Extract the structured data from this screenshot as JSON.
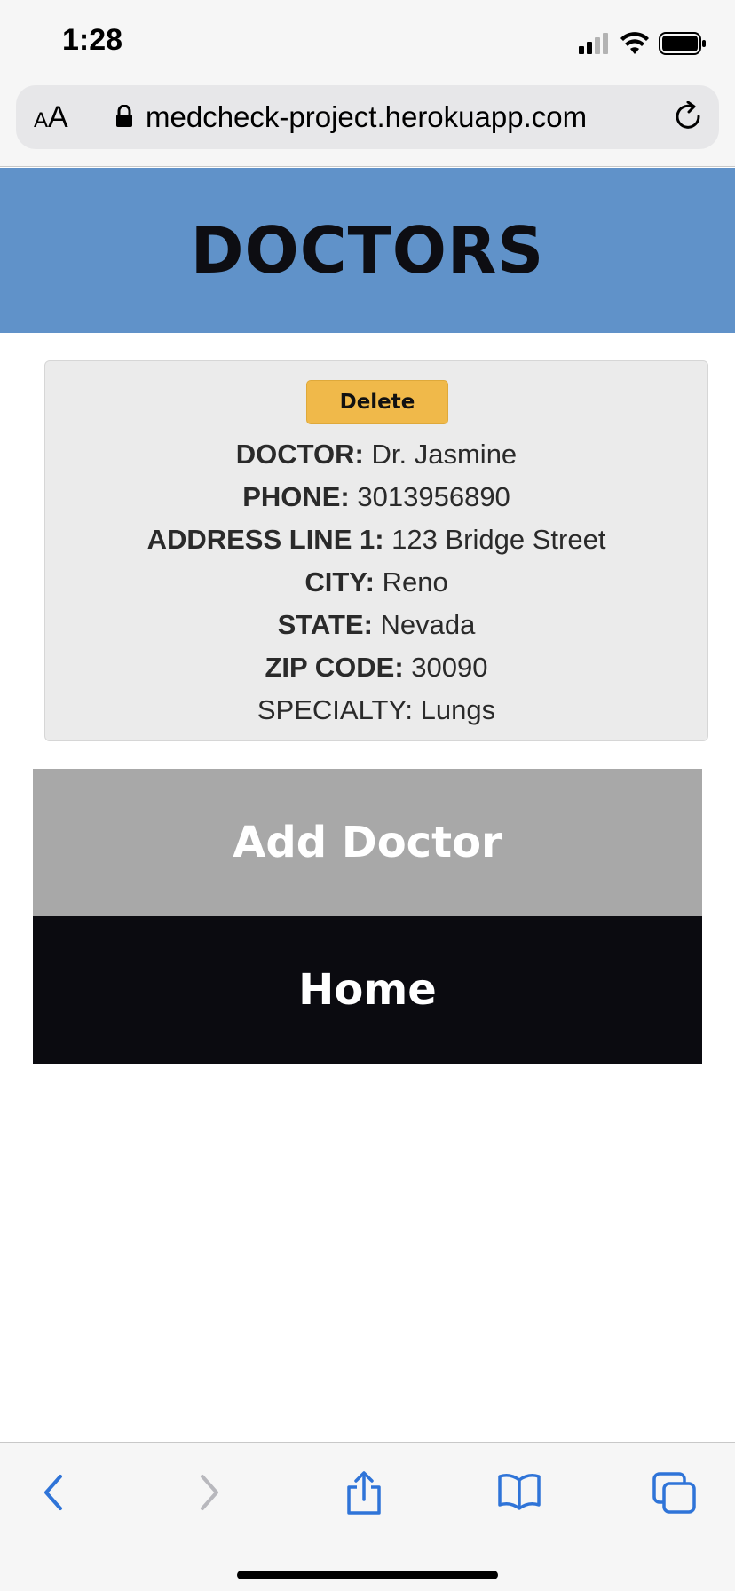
{
  "status_bar": {
    "time": "1:28",
    "icons": [
      "signal-icon",
      "wifi-icon",
      "battery-icon"
    ]
  },
  "browser": {
    "text_size_label_small": "A",
    "text_size_label_large": "A",
    "url": "medcheck-project.herokuapp.com"
  },
  "header": {
    "title": "DOCTORS",
    "background": "#6092c9"
  },
  "doctor_card": {
    "delete_label": "Delete",
    "fields": [
      {
        "label": "DOCTOR:",
        "value": "Dr. Jasmine"
      },
      {
        "label": "PHONE:",
        "value": "3013956890"
      },
      {
        "label": "ADDRESS LINE 1:",
        "value": "123 Bridge Street"
      },
      {
        "label": "CITY:",
        "value": "Reno"
      },
      {
        "label": "STATE:",
        "value": "Nevada"
      },
      {
        "label": "ZIP CODE:",
        "value": "30090"
      },
      {
        "label": "SPECIALTY: Lungs",
        "value": ""
      }
    ]
  },
  "actions": {
    "add_doctor_label": "Add Doctor",
    "home_label": "Home"
  },
  "toolbar": {
    "icons": [
      "back-icon",
      "forward-icon",
      "share-icon",
      "bookmarks-icon",
      "tabs-icon"
    ],
    "accent_color": "#2f74d8"
  }
}
